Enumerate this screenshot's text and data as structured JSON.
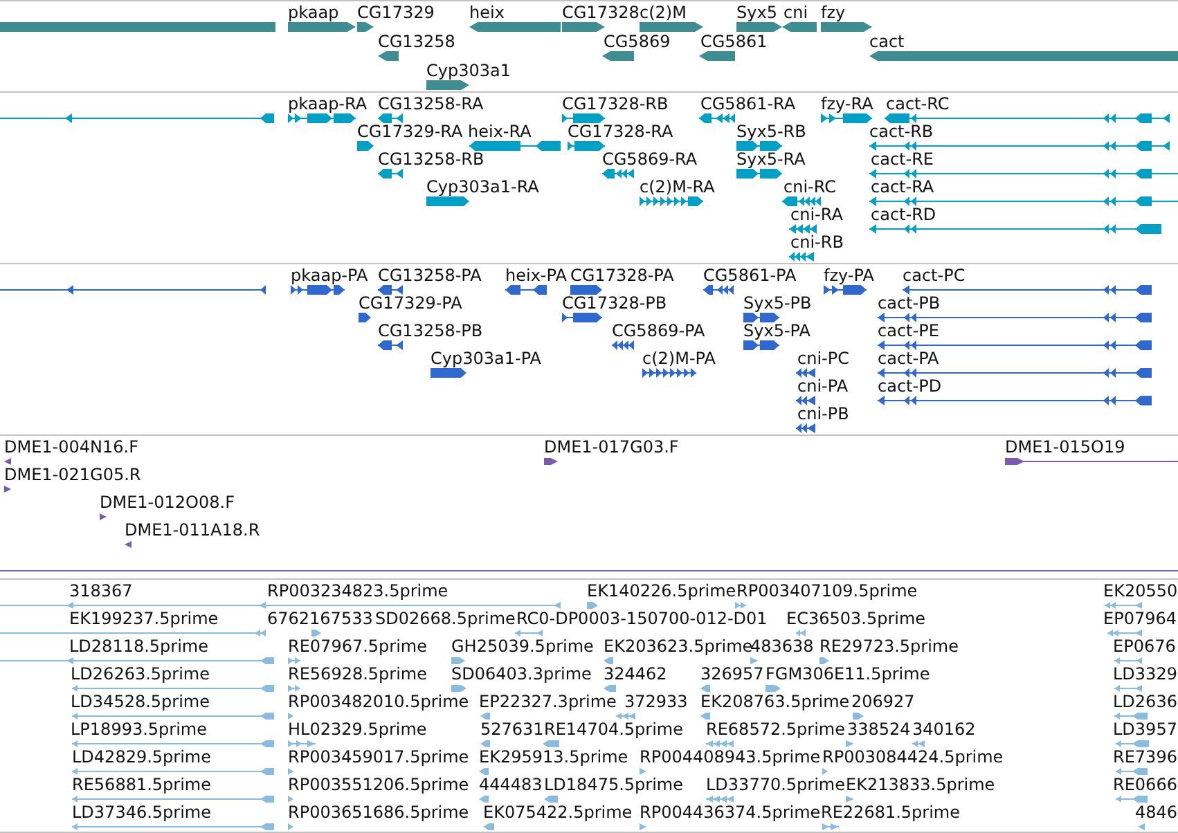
{
  "tracks": [
    {
      "kind": "gene",
      "rows": [
        {
          "features": [
            {
              "reverse": true
            },
            {
              "label": "pkaap",
              "reverse": false
            },
            {
              "label": "CG17329",
              "reverse": false
            },
            {
              "label": "heix",
              "reverse": true
            },
            {
              "label": "CG17328",
              "reverse": false
            },
            {
              "label": "c(2)M",
              "reverse": false
            },
            {
              "label": "Syx5",
              "reverse": false
            },
            {
              "label": "cni",
              "reverse": true
            },
            {
              "label": "fzy",
              "reverse": false
            }
          ]
        },
        {
          "features": [
            {
              "label": "CG13258",
              "reverse": true
            },
            {
              "label": "CG5869",
              "reverse": true
            },
            {
              "label": "CG5861",
              "reverse": true
            },
            {
              "label": "cact",
              "reverse": true
            }
          ]
        },
        {
          "features": [
            {
              "label": "Cyp303a1",
              "reverse": false
            }
          ]
        }
      ]
    },
    {
      "kind": "transcript",
      "rows": [
        {
          "features": [
            {
              "reverse": true
            },
            {
              "label": "pkaap-RA",
              "reverse": false
            },
            {
              "label": "CG13258-RA",
              "reverse": true
            },
            {
              "label": "CG17328-RB",
              "reverse": false
            },
            {
              "label": "CG5861-RA",
              "reverse": true
            },
            {
              "label": "fzy-RA",
              "reverse": false
            },
            {
              "label": "cact-RC",
              "reverse": true
            }
          ]
        },
        {
          "features": [
            {
              "label": "CG17329-RA",
              "reverse": false
            },
            {
              "label": "heix-RA",
              "reverse": true
            },
            {
              "label": "CG17328-RA",
              "reverse": false
            },
            {
              "label": "Syx5-RB",
              "reverse": false
            },
            {
              "label": "cact-RB",
              "reverse": true
            }
          ]
        },
        {
          "features": [
            {
              "label": "CG13258-RB",
              "reverse": true
            },
            {
              "label": "CG5869-RA",
              "reverse": true
            },
            {
              "label": "Syx5-RA",
              "reverse": false
            },
            {
              "label": "cact-RE",
              "reverse": true
            }
          ]
        },
        {
          "features": [
            {
              "label": "Cyp303a1-RA",
              "reverse": false
            },
            {
              "label": "c(2)M-RA",
              "reverse": false
            },
            {
              "label": "cni-RC",
              "reverse": true
            },
            {
              "label": "cact-RA",
              "reverse": true
            }
          ]
        },
        {
          "features": [
            {
              "label": "cni-RA",
              "reverse": true
            },
            {
              "label": "cact-RD",
              "reverse": true
            }
          ]
        },
        {
          "features": [
            {
              "label": "cni-RB",
              "reverse": true
            }
          ]
        }
      ]
    },
    {
      "kind": "protein",
      "rows": [
        {
          "features": [
            {
              "reverse": true
            },
            {
              "label": "pkaap-PA",
              "reverse": false
            },
            {
              "label": "CG13258-PA",
              "reverse": true
            },
            {
              "label": "heix-PA",
              "reverse": true
            },
            {
              "label": "CG17328-PA",
              "reverse": false
            },
            {
              "label": "CG5861-PA",
              "reverse": true
            },
            {
              "label": "fzy-PA",
              "reverse": false
            },
            {
              "label": "cact-PC",
              "reverse": true
            }
          ]
        },
        {
          "features": [
            {
              "label": "CG17329-PA",
              "reverse": false
            },
            {
              "label": "CG17328-PB",
              "reverse": false
            },
            {
              "label": "Syx5-PB",
              "reverse": false
            },
            {
              "label": "cact-PB",
              "reverse": true
            }
          ]
        },
        {
          "features": [
            {
              "label": "CG13258-PB",
              "reverse": true
            },
            {
              "label": "CG5869-PA",
              "reverse": true
            },
            {
              "label": "Syx5-PA",
              "reverse": false
            },
            {
              "label": "cact-PE",
              "reverse": true
            }
          ]
        },
        {
          "features": [
            {
              "label": "Cyp303a1-PA",
              "reverse": false
            },
            {
              "label": "c(2)M-PA",
              "reverse": false
            },
            {
              "label": "cni-PC",
              "reverse": true
            },
            {
              "label": "cact-PA",
              "reverse": true
            }
          ]
        },
        {
          "features": [
            {
              "label": "cni-PA",
              "reverse": true
            },
            {
              "label": "cact-PD",
              "reverse": true
            }
          ]
        },
        {
          "features": [
            {
              "label": "cni-PB",
              "reverse": true
            }
          ]
        }
      ]
    },
    {
      "kind": "clone",
      "rows": [
        {
          "features": [
            {
              "label": "DME1-004N16.F",
              "reverse": true
            },
            {
              "label": "DME1-017G03.F",
              "reverse": false
            },
            {
              "label": "DME1-015O19",
              "reverse": false
            }
          ]
        },
        {
          "features": [
            {
              "label": "DME1-021G05.R",
              "reverse": false
            }
          ]
        },
        {
          "features": [
            {
              "label": "DME1-012O08.F",
              "reverse": false
            }
          ]
        },
        {
          "features": [
            {
              "label": "DME1-011A18.R",
              "reverse": true
            }
          ]
        }
      ]
    },
    {
      "kind": "est",
      "rows": [
        {
          "features": [
            {
              "label": "318367",
              "reverse": true
            },
            {
              "label": "RP003234823.5prime",
              "reverse": true
            },
            {
              "label": "EK140226.5prime",
              "reverse": false
            },
            {
              "label": "RP003407109.5prime",
              "reverse": false
            },
            {
              "label": "EK20550",
              "reverse": true
            }
          ]
        },
        {
          "features": [
            {
              "label": "EK199237.5prime",
              "reverse": true
            },
            {
              "label": "6762167533",
              "reverse": false
            },
            {
              "label": "SD02668.5prime"
            },
            {
              "label": "RC0-DP0003-150700-012-D01",
              "reverse": true
            },
            {
              "label": "EC36503.5prime",
              "reverse": true
            },
            {
              "label": "EP07964",
              "reverse": true
            }
          ]
        },
        {
          "features": [
            {
              "label": "LD28118.5prime",
              "reverse": true
            },
            {
              "label": "RE07967.5prime",
              "reverse": false
            },
            {
              "label": "GH25039.5prime",
              "reverse": false
            },
            {
              "label": "EK203623.5prime",
              "reverse": true
            },
            {
              "label": "483638",
              "reverse": false
            },
            {
              "label": "RE29723.5prime",
              "reverse": false
            },
            {
              "label": "EP0676",
              "reverse": true
            }
          ]
        },
        {
          "features": [
            {
              "label": "LD26263.5prime",
              "reverse": true
            },
            {
              "label": "RE56928.5prime",
              "reverse": false
            },
            {
              "label": "SD06403.3prime",
              "reverse": false
            },
            {
              "label": "324462",
              "reverse": true
            },
            {
              "label": "326957",
              "reverse": true
            },
            {
              "label": "FGM306E11.5prime",
              "reverse": false
            },
            {
              "label": "LD3329",
              "reverse": true
            }
          ]
        },
        {
          "features": [
            {
              "label": "LD34528.5prime",
              "reverse": true
            },
            {
              "label": "RP003482010.5prime",
              "reverse": false
            },
            {
              "label": "EP22327.3prime",
              "reverse": true
            },
            {
              "label": "372933",
              "reverse": true
            },
            {
              "label": "EK208763.5prime",
              "reverse": true
            },
            {
              "label": "206927",
              "reverse": false
            },
            {
              "label": "LD2636",
              "reverse": true
            }
          ]
        },
        {
          "features": [
            {
              "label": "LP18993.5prime",
              "reverse": true
            },
            {
              "label": "HL02329.5prime",
              "reverse": false
            },
            {
              "label": "527631",
              "reverse": true
            },
            {
              "label": "RE14704.5prime",
              "reverse": true
            },
            {
              "label": "RE68572.5prime",
              "reverse": true
            },
            {
              "label": "338524",
              "reverse": false
            },
            {
              "label": "340162",
              "reverse": true
            },
            {
              "label": "LD3957",
              "reverse": true
            }
          ]
        },
        {
          "features": [
            {
              "label": "LD42829.5prime",
              "reverse": true
            },
            {
              "label": "RP003459017.5prime",
              "reverse": false
            },
            {
              "label": "EK295913.5prime",
              "reverse": true
            },
            {
              "label": "RP004408943.5prime",
              "reverse": false
            },
            {
              "label": "RP003084424.5prime",
              "reverse": false
            },
            {
              "label": "RE7396",
              "reverse": true
            }
          ]
        },
        {
          "features": [
            {
              "label": "RE56881.5prime",
              "reverse": true
            },
            {
              "label": "RP003551206.5prime",
              "reverse": false
            },
            {
              "label": "444483",
              "reverse": true
            },
            {
              "label": "LD18475.5prime",
              "reverse": true
            },
            {
              "label": "LD33770.5prime",
              "reverse": true
            },
            {
              "label": "EK213833.5prime",
              "reverse": false
            },
            {
              "label": "RE0666",
              "reverse": true
            }
          ]
        },
        {
          "features": [
            {
              "label": "LD37346.5prime",
              "reverse": true
            },
            {
              "label": "RP003651686.5prime",
              "reverse": false
            },
            {
              "label": "EK075422.5prime",
              "reverse": true
            },
            {
              "label": "RP004436374.5prime",
              "reverse": false
            },
            {
              "label": "RE22681.5prime",
              "reverse": false
            },
            {
              "label": "4846",
              "reverse": true
            }
          ]
        }
      ]
    }
  ]
}
